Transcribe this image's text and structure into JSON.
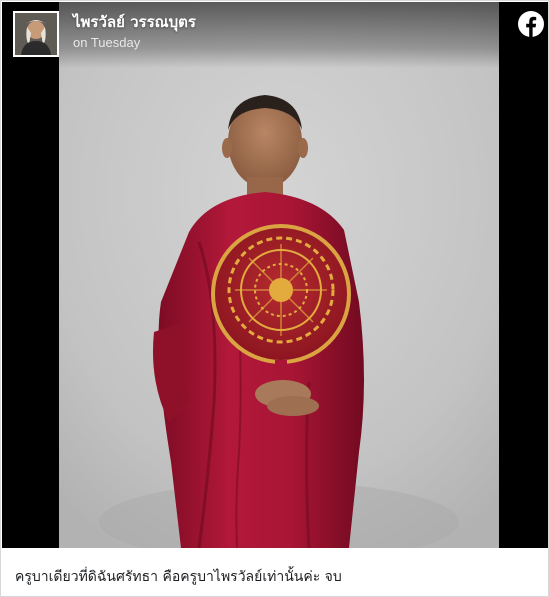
{
  "post": {
    "author": "ไพรวัลย์ วรรณบุตร",
    "timestamp": "on Tuesday",
    "caption": "ครูบาเดียวที่ดิฉันศรัทธา คือครูบาไพรวัลย์เท่านั้นค่ะ จบ"
  },
  "icons": {
    "brand": "facebook-icon",
    "brand_color": "#ffffff",
    "brand_glyph_color": "#000000"
  },
  "colors": {
    "robe": "#b01737",
    "backdrop": "#c9c9c9",
    "fan_gold": "#e0a33a"
  }
}
